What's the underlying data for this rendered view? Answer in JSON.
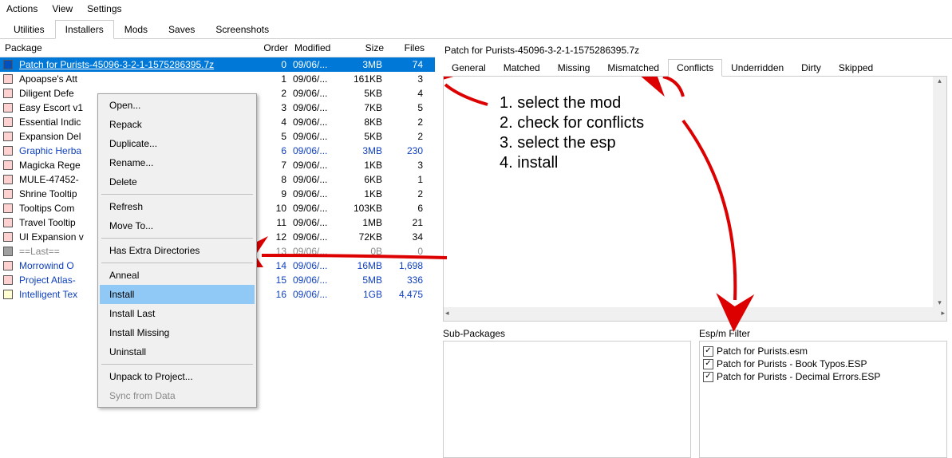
{
  "menubar": [
    "Actions",
    "View",
    "Settings"
  ],
  "tabs": {
    "items": [
      "Utilities",
      "Installers",
      "Mods",
      "Saves",
      "Screenshots"
    ],
    "active": 1
  },
  "columns": {
    "pkg": "Package",
    "order": "Order",
    "modified": "Modified",
    "size": "Size",
    "files": "Files"
  },
  "packages": [
    {
      "name": "Patch for Purists-45096-3-2-1-1575286395.7z",
      "order": 0,
      "modified": "09/06/...",
      "size": "3MB",
      "files": 74,
      "color": "blue",
      "selected": true,
      "style": "white"
    },
    {
      "name": "Apoapse's Att",
      "order": 1,
      "modified": "09/06/...",
      "size": "161KB",
      "files": 3,
      "color": "pink"
    },
    {
      "name": "Diligent Defe",
      "order": 2,
      "modified": "09/06/...",
      "size": "5KB",
      "files": 4,
      "color": "pink"
    },
    {
      "name": "Easy Escort v1",
      "order": 3,
      "modified": "09/06/...",
      "size": "7KB",
      "files": 5,
      "color": "pink"
    },
    {
      "name": "Essential Indic",
      "order": 4,
      "modified": "09/06/...",
      "size": "8KB",
      "files": 2,
      "color": "pink"
    },
    {
      "name": "Expansion Del",
      "order": 5,
      "modified": "09/06/...",
      "size": "5KB",
      "files": 2,
      "color": "pink"
    },
    {
      "name": "Graphic Herba",
      "order": 6,
      "modified": "09/06/...",
      "size": "3MB",
      "files": 230,
      "color": "pink",
      "style": "blue"
    },
    {
      "name": "Magicka Rege",
      "order": 7,
      "modified": "09/06/...",
      "size": "1KB",
      "files": 3,
      "color": "pink"
    },
    {
      "name": "MULE-47452-",
      "order": 8,
      "modified": "09/06/...",
      "size": "6KB",
      "files": 1,
      "color": "pink"
    },
    {
      "name": "Shrine Tooltip",
      "order": 9,
      "modified": "09/06/...",
      "size": "1KB",
      "files": 2,
      "color": "pink"
    },
    {
      "name": "Tooltips Com",
      "order": 10,
      "modified": "09/06/...",
      "size": "103KB",
      "files": 6,
      "color": "pink"
    },
    {
      "name": "Travel Tooltip",
      "order": 11,
      "modified": "09/06/...",
      "size": "1MB",
      "files": 21,
      "color": "pink"
    },
    {
      "name": "UI Expansion v",
      "order": 12,
      "modified": "09/06/...",
      "size": "72KB",
      "files": 34,
      "color": "pink"
    },
    {
      "name": "==Last==",
      "order": 13,
      "modified": "09/06/...",
      "size": "0B",
      "files": 0,
      "color": "gray",
      "style": "gray"
    },
    {
      "name": "Morrowind O",
      "order": 14,
      "modified": "09/06/...",
      "size": "16MB",
      "files": "1,698",
      "color": "pink",
      "style": "blue"
    },
    {
      "name": "Project Atlas-",
      "order": 15,
      "modified": "09/06/...",
      "size": "5MB",
      "files": 336,
      "color": "pink",
      "style": "blue"
    },
    {
      "name": "Intelligent Tex",
      "order": 16,
      "modified": "09/06/...",
      "size": "1GB",
      "files": "4,475",
      "color": "yellow",
      "style": "blue"
    }
  ],
  "context_menu": [
    {
      "label": "Open..."
    },
    {
      "label": "Repack"
    },
    {
      "label": "Duplicate..."
    },
    {
      "label": "Rename..."
    },
    {
      "label": "Delete"
    },
    {
      "sep": true
    },
    {
      "label": "Refresh"
    },
    {
      "label": "Move To..."
    },
    {
      "sep": true
    },
    {
      "label": "Has Extra Directories"
    },
    {
      "sep": true
    },
    {
      "label": "Anneal"
    },
    {
      "label": "Install",
      "hover": true
    },
    {
      "label": "Install Last"
    },
    {
      "label": "Install Missing"
    },
    {
      "label": "Uninstall"
    },
    {
      "sep": true
    },
    {
      "label": "Unpack to Project..."
    },
    {
      "label": "Sync from Data",
      "disabled": true
    }
  ],
  "right": {
    "title": "Patch for Purists-45096-3-2-1-1575286395.7z",
    "tabs": {
      "items": [
        "General",
        "Matched",
        "Missing",
        "Mismatched",
        "Conflicts",
        "Underridden",
        "Dirty",
        "Skipped"
      ],
      "active": 4
    },
    "instructions": [
      "1. select the mod",
      "2. check for conflicts",
      "3. select the esp",
      "4. install"
    ],
    "sub_packages_title": "Sub-Packages",
    "espm_title": "Esp/m Filter",
    "espm_items": [
      "Patch for Purists.esm",
      "Patch for Purists - Book Typos.ESP",
      "Patch for Purists - Decimal Errors.ESP"
    ]
  },
  "checkmark": "✓"
}
